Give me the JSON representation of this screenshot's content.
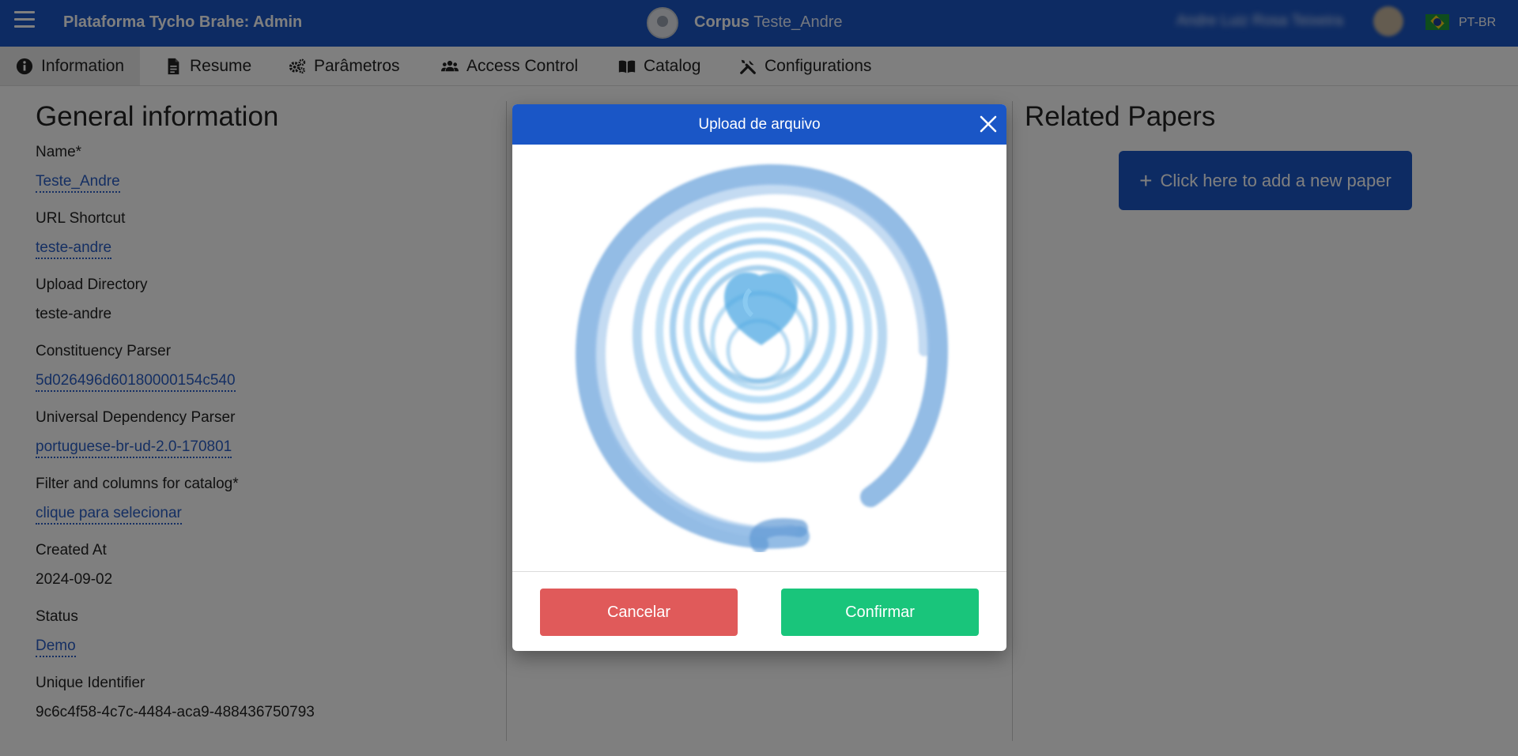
{
  "header": {
    "app_title": "Plataforma Tycho Brahe: Admin",
    "corpus_prefix": "Corpus",
    "corpus_name": "Teste_Andre",
    "user_name": "Andre Luiz Rosa Teixeira",
    "language": "PT-BR"
  },
  "tabs": [
    {
      "label": "Information",
      "icon": "info-circle-icon",
      "active": true
    },
    {
      "label": "Resume",
      "icon": "file-text-icon"
    },
    {
      "label": "Parâmetros",
      "icon": "cogs-icon"
    },
    {
      "label": "Access Control",
      "icon": "users-icon"
    },
    {
      "label": "Catalog",
      "icon": "book-open-icon"
    },
    {
      "label": "Configurations",
      "icon": "tools-icon"
    }
  ],
  "general": {
    "title": "General information",
    "fields": [
      {
        "label": "Name*",
        "value": "Teste_Andre",
        "editable": true
      },
      {
        "label": "URL Shortcut",
        "value": "teste-andre",
        "editable": true
      },
      {
        "label": "Upload Directory",
        "value": "teste-andre",
        "editable": false
      },
      {
        "label": "Constituency Parser",
        "value": "5d026496d60180000154c540",
        "editable": true
      },
      {
        "label": "Universal Dependency Parser",
        "value": "portuguese-br-ud-2.0-170801",
        "editable": true
      },
      {
        "label": "Filter and columns for catalog*",
        "value": "clique para selecionar",
        "editable": true
      },
      {
        "label": "Created At",
        "value": "2024-09-02",
        "editable": false
      },
      {
        "label": "Status",
        "value": "Demo",
        "editable": true
      },
      {
        "label": "Unique Identifier",
        "value": "9c6c4f58-4c7c-4484-aca9-488436750793",
        "editable": false
      }
    ]
  },
  "related": {
    "title": "Related Papers",
    "add_button": "Click here to add a new paper"
  },
  "modal": {
    "title": "Upload de arquivo",
    "cancel_label": "Cancelar",
    "confirm_label": "Confirmar"
  },
  "colors": {
    "brand_blue": "#1a56c6",
    "link_blue": "#2a5fc6",
    "cancel_red": "#e05a5a",
    "confirm_green": "#19c57b"
  }
}
